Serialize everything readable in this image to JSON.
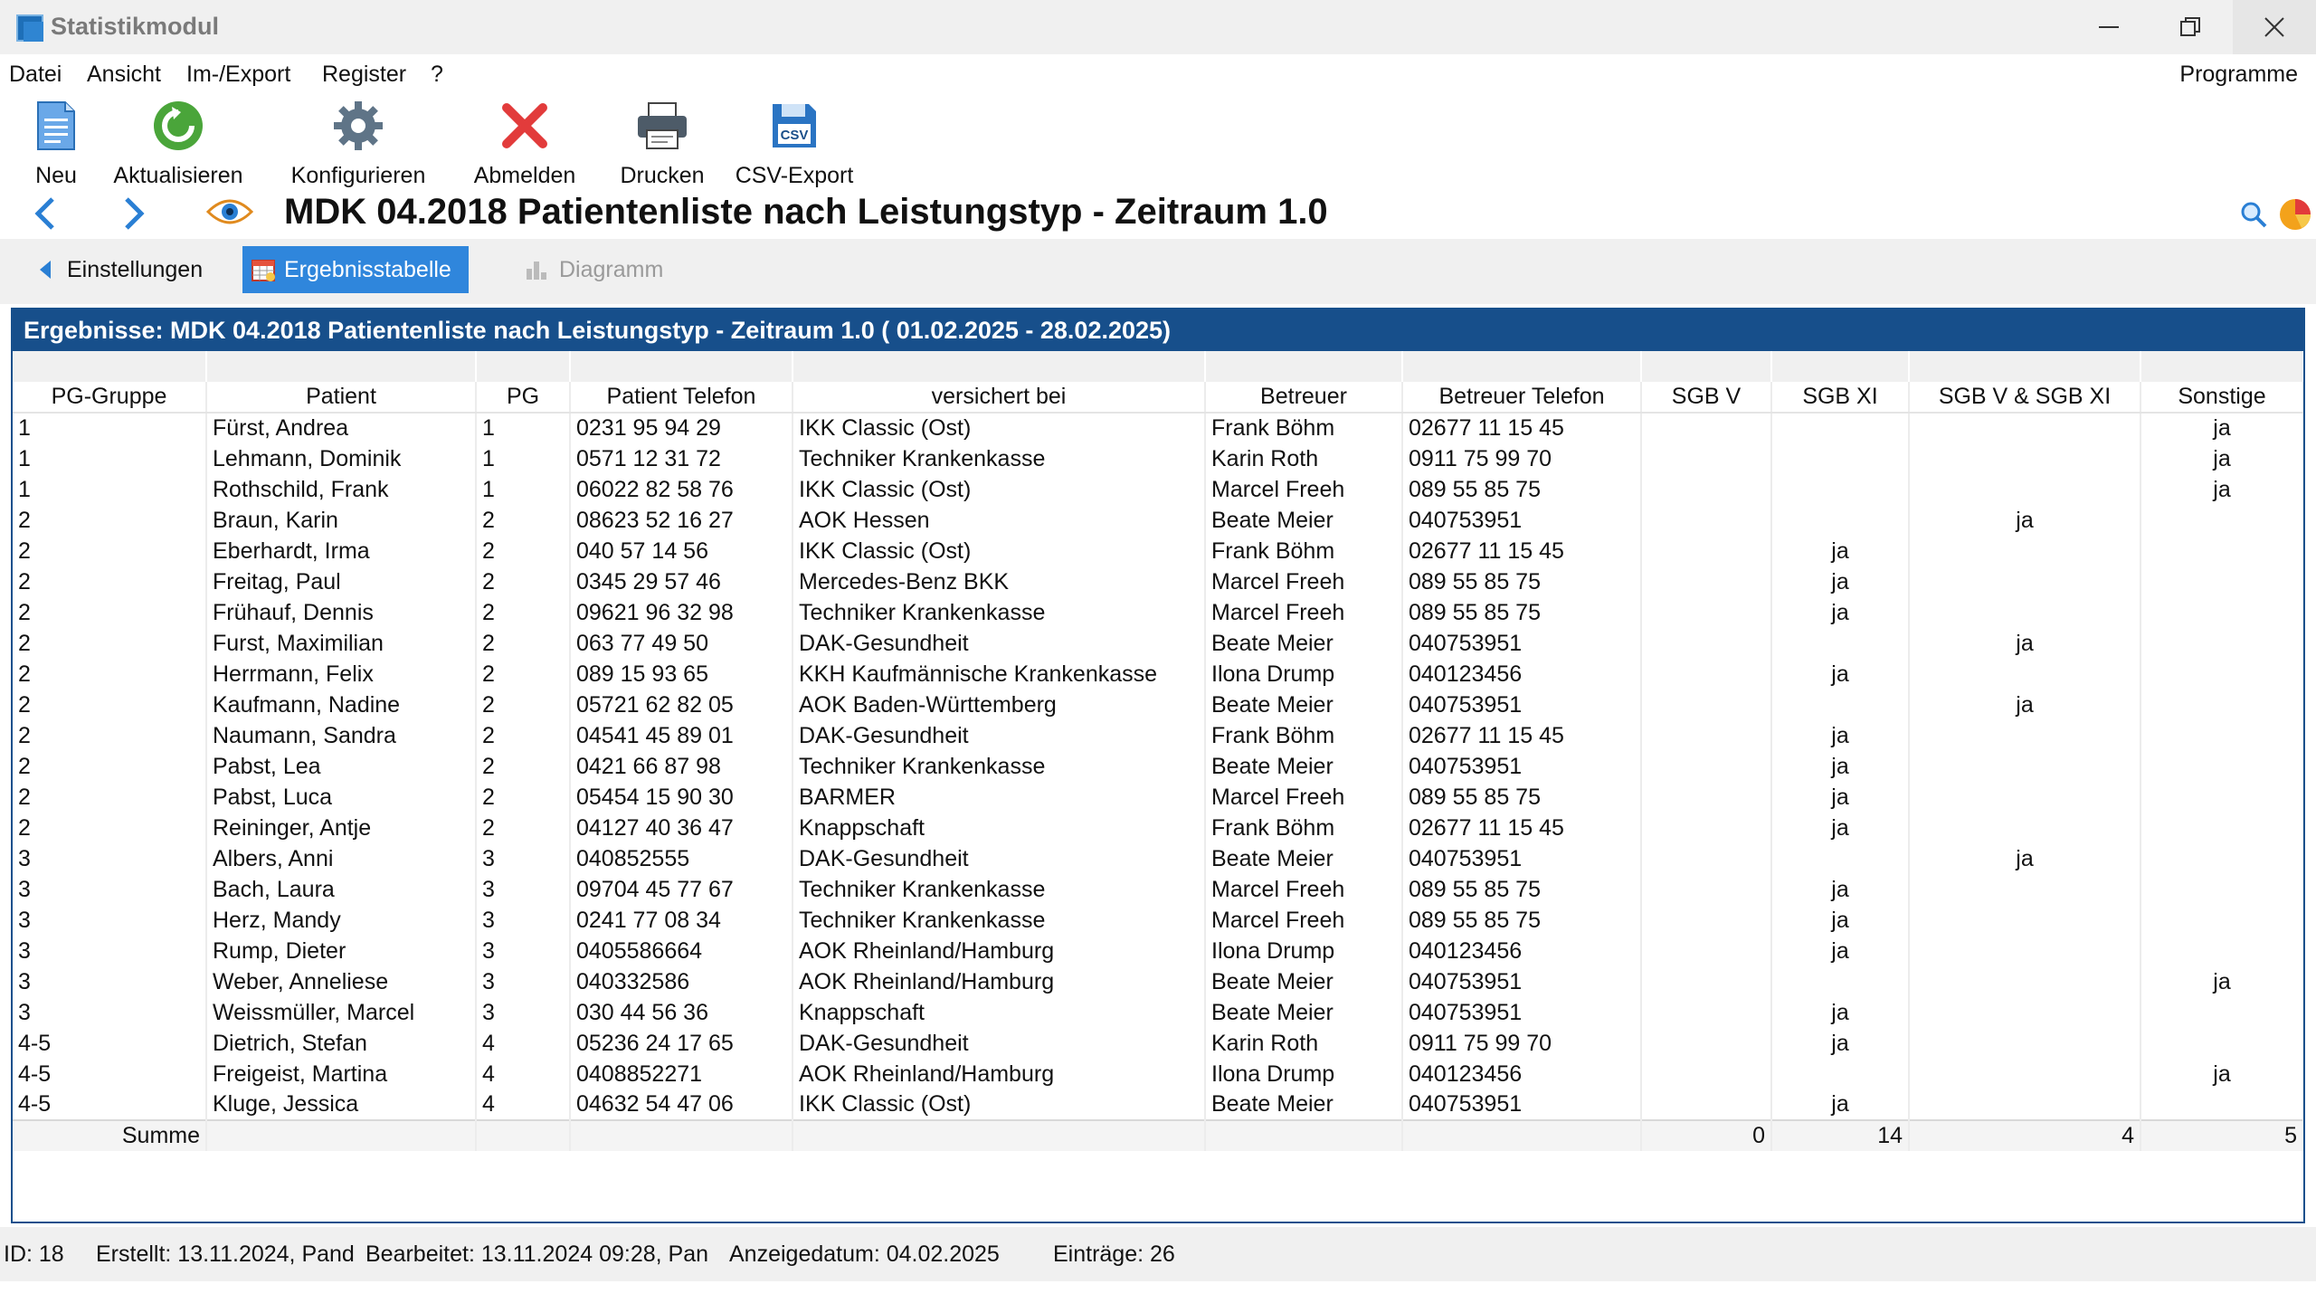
{
  "window": {
    "title": "Statistikmodul"
  },
  "menu": {
    "items": [
      "Datei",
      "Ansicht",
      "Im-/Export",
      "Register",
      "?"
    ],
    "programme": "Programme"
  },
  "toolbar": {
    "neu": "Neu",
    "aktualisieren": "Aktualisieren",
    "konfigurieren": "Konfigurieren",
    "abmelden": "Abmelden",
    "drucken": "Drucken",
    "csv_export": "CSV-Export",
    "csv_icon_text": "CSV"
  },
  "report": {
    "title": "MDK 04.2018 Patientenliste nach Leistungstyp - Zeitraum 1.0"
  },
  "tabs": {
    "einstellungen": "Einstellungen",
    "ergebnistabelle": "Ergebnisstabelle",
    "diagramm": "Diagramm"
  },
  "results": {
    "header": "Ergebnisse: MDK 04.2018 Patientenliste nach Leistungstyp - Zeitraum 1.0 ( 01.02.2025 - 28.02.2025)",
    "columns": [
      "PG-Gruppe",
      "Patient",
      "PG",
      "Patient Telefon",
      "versichert bei",
      "Betreuer",
      "Betreuer Telefon",
      "SGB V",
      "SGB XI",
      "SGB V & SGB XI",
      "Sonstige"
    ],
    "rows": [
      [
        "1",
        "Fürst, Andrea",
        "1",
        "0231 95 94 29",
        "IKK Classic (Ost)",
        "Frank Böhm",
        "02677 11 15 45",
        "",
        "",
        "",
        "ja"
      ],
      [
        "1",
        "Lehmann, Dominik",
        "1",
        "0571 12 31 72",
        "Techniker Krankenkasse",
        "Karin Roth",
        "0911 75 99 70",
        "",
        "",
        "",
        "ja"
      ],
      [
        "1",
        "Rothschild, Frank",
        "1",
        "06022 82 58 76",
        "IKK Classic (Ost)",
        "Marcel Freeh",
        "089 55 85 75",
        "",
        "",
        "",
        "ja"
      ],
      [
        "2",
        "Braun, Karin",
        "2",
        "08623 52 16 27",
        "AOK Hessen",
        "Beate Meier",
        "040753951",
        "",
        "",
        "ja",
        ""
      ],
      [
        "2",
        "Eberhardt, Irma",
        "2",
        "040 57 14 56",
        "IKK Classic (Ost)",
        "Frank Böhm",
        "02677 11 15 45",
        "",
        "ja",
        "",
        ""
      ],
      [
        "2",
        "Freitag, Paul",
        "2",
        "0345 29 57 46",
        "Mercedes-Benz BKK",
        "Marcel Freeh",
        "089 55 85 75",
        "",
        "ja",
        "",
        ""
      ],
      [
        "2",
        "Frühauf, Dennis",
        "2",
        "09621 96 32 98",
        "Techniker Krankenkasse",
        "Marcel Freeh",
        "089 55 85 75",
        "",
        "ja",
        "",
        ""
      ],
      [
        "2",
        "Furst, Maximilian",
        "2",
        "063 77 49 50",
        "DAK-Gesundheit",
        "Beate Meier",
        "040753951",
        "",
        "",
        "ja",
        ""
      ],
      [
        "2",
        "Herrmann, Felix",
        "2",
        "089 15 93 65",
        "KKH Kaufmännische Krankenkasse",
        "Ilona Drump",
        "040123456",
        "",
        "ja",
        "",
        ""
      ],
      [
        "2",
        "Kaufmann, Nadine",
        "2",
        "05721 62 82 05",
        "AOK Baden-Württemberg",
        "Beate Meier",
        "040753951",
        "",
        "",
        "ja",
        ""
      ],
      [
        "2",
        "Naumann, Sandra",
        "2",
        "04541 45 89 01",
        "DAK-Gesundheit",
        "Frank Böhm",
        "02677 11 15 45",
        "",
        "ja",
        "",
        ""
      ],
      [
        "2",
        "Pabst, Lea",
        "2",
        "0421 66 87 98",
        "Techniker Krankenkasse",
        "Beate Meier",
        "040753951",
        "",
        "ja",
        "",
        ""
      ],
      [
        "2",
        "Pabst, Luca",
        "2",
        "05454 15 90 30",
        "BARMER",
        "Marcel Freeh",
        "089 55 85 75",
        "",
        "ja",
        "",
        ""
      ],
      [
        "2",
        "Reininger, Antje",
        "2",
        "04127 40 36 47",
        "Knappschaft",
        "Frank Böhm",
        "02677 11 15 45",
        "",
        "ja",
        "",
        ""
      ],
      [
        "3",
        "Albers, Anni",
        "3",
        "040852555",
        "DAK-Gesundheit",
        "Beate Meier",
        "040753951",
        "",
        "",
        "ja",
        ""
      ],
      [
        "3",
        "Bach, Laura",
        "3",
        "09704 45 77 67",
        "Techniker Krankenkasse",
        "Marcel Freeh",
        "089 55 85 75",
        "",
        "ja",
        "",
        ""
      ],
      [
        "3",
        "Herz, Mandy",
        "3",
        "0241 77 08 34",
        "Techniker Krankenkasse",
        "Marcel Freeh",
        "089 55 85 75",
        "",
        "ja",
        "",
        ""
      ],
      [
        "3",
        "Rump, Dieter",
        "3",
        "0405586664",
        "AOK Rheinland/Hamburg",
        "Ilona Drump",
        "040123456",
        "",
        "ja",
        "",
        ""
      ],
      [
        "3",
        "Weber, Anneliese",
        "3",
        "040332586",
        "AOK Rheinland/Hamburg",
        "Beate Meier",
        "040753951",
        "",
        "",
        "",
        "ja"
      ],
      [
        "3",
        "Weissmüller, Marcel",
        "3",
        "030 44 56 36",
        "Knappschaft",
        "Beate Meier",
        "040753951",
        "",
        "ja",
        "",
        ""
      ],
      [
        "4-5",
        "Dietrich, Stefan",
        "4",
        "05236 24 17 65",
        "DAK-Gesundheit",
        "Karin Roth",
        "0911 75 99 70",
        "",
        "ja",
        "",
        ""
      ],
      [
        "4-5",
        "Freigeist, Martina",
        "4",
        "0408852271",
        "AOK Rheinland/Hamburg",
        "Ilona Drump",
        "040123456",
        "",
        "",
        "",
        "ja"
      ],
      [
        "4-5",
        "Kluge, Jessica",
        "4",
        "04632 54 47 06",
        "IKK Classic (Ost)",
        "Beate Meier",
        "040753951",
        "",
        "ja",
        "",
        ""
      ]
    ],
    "summary": {
      "label": "Summe",
      "sgb_v": "0",
      "sgb_xi": "14",
      "sgb_v_xi": "4",
      "sonstige": "5"
    }
  },
  "status": {
    "id": "ID: 18",
    "erstellt": "Erstellt: 13.11.2024, Pand",
    "bearbeitet": "Bearbeitet: 13.11.2024 09:28, Pan",
    "anzeigedatum": "Anzeigedatum: 04.02.2025",
    "eintraege": "Einträge: 26"
  },
  "colors": {
    "accent": "#2f86dc",
    "header_bg": "#174f8b",
    "close_red": "#e23b3b",
    "refresh_green": "#4aa53a"
  },
  "icons": [
    "app-icon",
    "new-document-icon",
    "refresh-icon",
    "gear-icon",
    "close-x-icon",
    "printer-icon",
    "csv-save-icon",
    "back-arrow-icon",
    "forward-arrow-icon",
    "eye-icon",
    "search-icon",
    "pie-chart-icon",
    "table-icon",
    "chart-icon"
  ]
}
